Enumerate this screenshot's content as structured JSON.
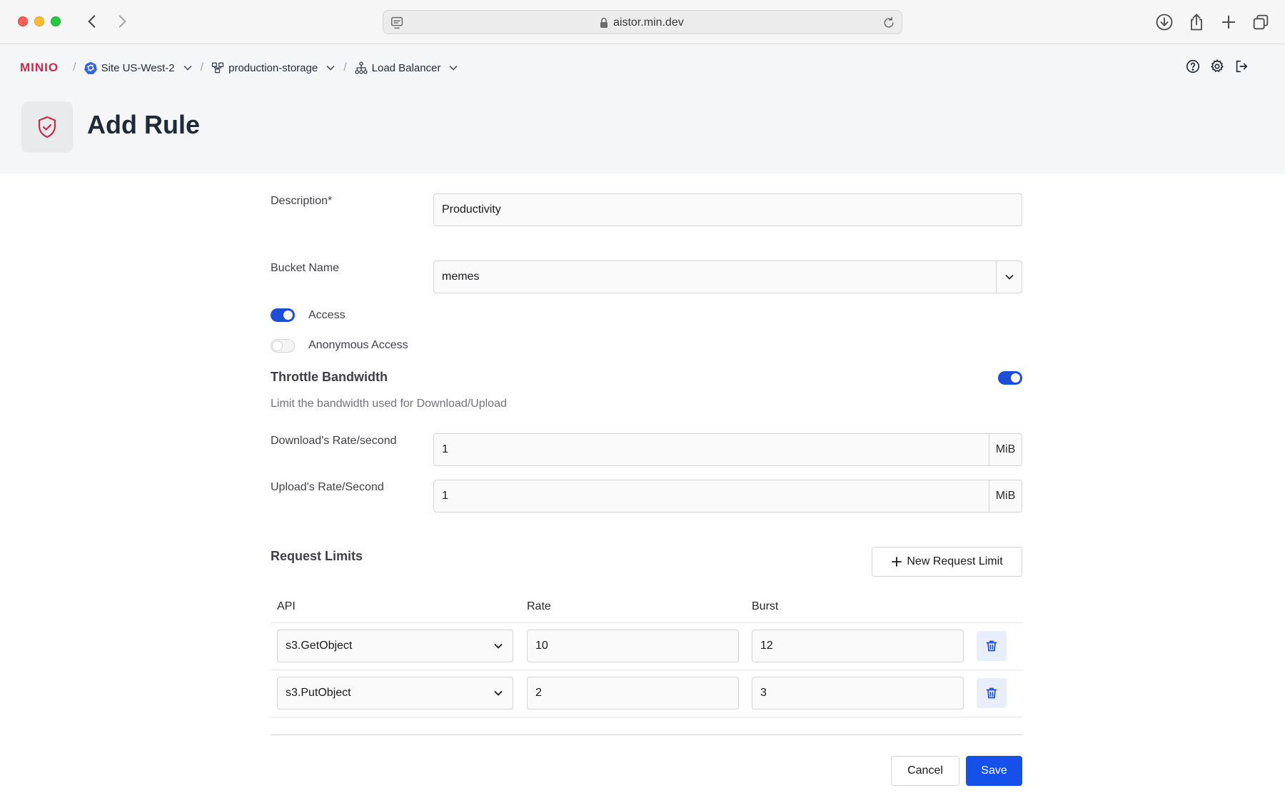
{
  "browser": {
    "url": "aistor.min.dev"
  },
  "app": {
    "logo_text": "MINIO",
    "breadcrumb": {
      "site": "Site US-West-2",
      "bucket_group": "production-storage",
      "section": "Load Balancer"
    },
    "page_title": "Add Rule"
  },
  "form": {
    "description": {
      "label": "Description*",
      "value": "Productivity"
    },
    "bucket": {
      "label": "Bucket Name",
      "value": "memes"
    },
    "access": {
      "label": "Access",
      "enabled": true
    },
    "anonymous_access": {
      "label": "Anonymous Access",
      "enabled": false
    },
    "throttle": {
      "title": "Throttle Bandwidth",
      "enabled": true,
      "helper": "Limit the bandwidth used for Download/Upload",
      "download": {
        "label": "Download's Rate/second",
        "value": "1",
        "unit": "MiB"
      },
      "upload": {
        "label": "Upload's Rate/Second",
        "value": "1",
        "unit": "MiB"
      }
    },
    "request_limits": {
      "title": "Request Limits",
      "new_button": "New Request Limit",
      "columns": {
        "api": "API",
        "rate": "Rate",
        "burst": "Burst"
      },
      "rows": [
        {
          "api": "s3.GetObject",
          "rate": "10",
          "burst": "12"
        },
        {
          "api": "s3.PutObject",
          "rate": "2",
          "burst": "3"
        }
      ]
    },
    "actions": {
      "cancel": "Cancel",
      "save": "Save"
    }
  },
  "colors": {
    "brand": "#c72c48",
    "primary": "#1650ea",
    "toggle_on": "#1d4ed8"
  }
}
